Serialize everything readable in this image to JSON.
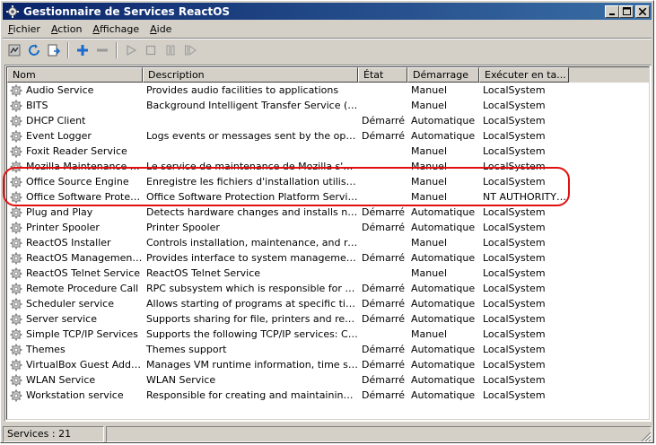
{
  "window": {
    "title": "Gestionnaire de Services ReactOS"
  },
  "menu": [
    {
      "label": "Fichier",
      "accel": "F",
      "rest": "ichier"
    },
    {
      "label": "Action",
      "accel": "A",
      "rest": "ction"
    },
    {
      "label": "Affichage",
      "accel": "A",
      "rest": "ffichage"
    },
    {
      "label": "Aide",
      "accel": "A",
      "rest": "ide"
    }
  ],
  "toolbar_icons": [
    "properties-icon",
    "refresh-icon",
    "export-icon",
    "add-icon",
    "remove-icon",
    "start-icon",
    "stop-icon",
    "pause-icon",
    "restart-icon"
  ],
  "columns": [
    "Nom",
    "Description",
    "État",
    "Démarrage",
    "Exécuter en ta..."
  ],
  "rows": [
    {
      "name": "Audio Service",
      "desc": "Provides audio facilities to applications",
      "state": "",
      "startup": "Manuel",
      "account": "LocalSystem"
    },
    {
      "name": "BITS",
      "desc": "Background Intelligent Transfer Service (BITS)",
      "state": "",
      "startup": "Manuel",
      "account": "LocalSystem"
    },
    {
      "name": "DHCP Client",
      "desc": "",
      "state": "Démarré",
      "startup": "Automatique",
      "account": "LocalSystem"
    },
    {
      "name": "Event Logger",
      "desc": "Logs events or messages sent by the operatin...",
      "state": "Démarré",
      "startup": "Automatique",
      "account": "LocalSystem"
    },
    {
      "name": "Foxit Reader Service",
      "desc": "",
      "state": "",
      "startup": "Manuel",
      "account": "LocalSystem"
    },
    {
      "name": "Mozilla Maintenance Ser...",
      "desc": "Le service de maintenance de Mozilla s'assure ...",
      "state": "",
      "startup": "Manuel",
      "account": "LocalSystem"
    },
    {
      "name": "Office  Source Engine",
      "desc": "Enregistre les fichiers d'installation utilisés pou...",
      "state": "",
      "startup": "Manuel",
      "account": "LocalSystem"
    },
    {
      "name": "Office Software Protecti...",
      "desc": "Office Software Protection Platform Service (u...",
      "state": "",
      "startup": "Manuel",
      "account": "NT AUTHORITY\\..."
    },
    {
      "name": "Plug and Play",
      "desc": "Detects hardware changes and installs neede...",
      "state": "Démarré",
      "startup": "Automatique",
      "account": "LocalSystem"
    },
    {
      "name": "Printer Spooler",
      "desc": "Printer Spooler",
      "state": "Démarré",
      "startup": "Automatique",
      "account": "LocalSystem"
    },
    {
      "name": "ReactOS Installer",
      "desc": "Controls installation, maintenance, and remov...",
      "state": "",
      "startup": "Manuel",
      "account": "LocalSystem"
    },
    {
      "name": "ReactOS Management I...",
      "desc": "Provides interface to system management info...",
      "state": "Démarré",
      "startup": "Automatique",
      "account": "LocalSystem"
    },
    {
      "name": "ReactOS Telnet Service",
      "desc": "ReactOS Telnet Service",
      "state": "",
      "startup": "Manuel",
      "account": "LocalSystem"
    },
    {
      "name": "Remote Procedure Call",
      "desc": "RPC subsystem which is responsible for Remot...",
      "state": "Démarré",
      "startup": "Automatique",
      "account": "LocalSystem"
    },
    {
      "name": "Scheduler service",
      "desc": "Allows starting of programs at specific times",
      "state": "Démarré",
      "startup": "Automatique",
      "account": "LocalSystem"
    },
    {
      "name": "Server service",
      "desc": "Supports sharing for file, printers and resourc...",
      "state": "Démarré",
      "startup": "Automatique",
      "account": "LocalSystem"
    },
    {
      "name": "Simple TCP/IP Services",
      "desc": "Supports the following TCP/IP services: Charg...",
      "state": "",
      "startup": "Manuel",
      "account": "LocalSystem"
    },
    {
      "name": "Themes",
      "desc": "Themes support",
      "state": "Démarré",
      "startup": "Automatique",
      "account": "LocalSystem"
    },
    {
      "name": "VirtualBox Guest Additio...",
      "desc": "Manages VM runtime information, time synchr...",
      "state": "Démarré",
      "startup": "Automatique",
      "account": "LocalSystem"
    },
    {
      "name": "WLAN Service",
      "desc": "WLAN Service",
      "state": "Démarré",
      "startup": "Automatique",
      "account": "LocalSystem"
    },
    {
      "name": "Workstation service",
      "desc": "Responsible for creating and maintaining netw...",
      "state": "Démarré",
      "startup": "Automatique",
      "account": "LocalSystem"
    }
  ],
  "status": {
    "text": "Services : 21"
  },
  "colors": {
    "highlight": "#e01010",
    "titlebar_start": "#0a246a",
    "titlebar_end": "#3a6ea5"
  }
}
